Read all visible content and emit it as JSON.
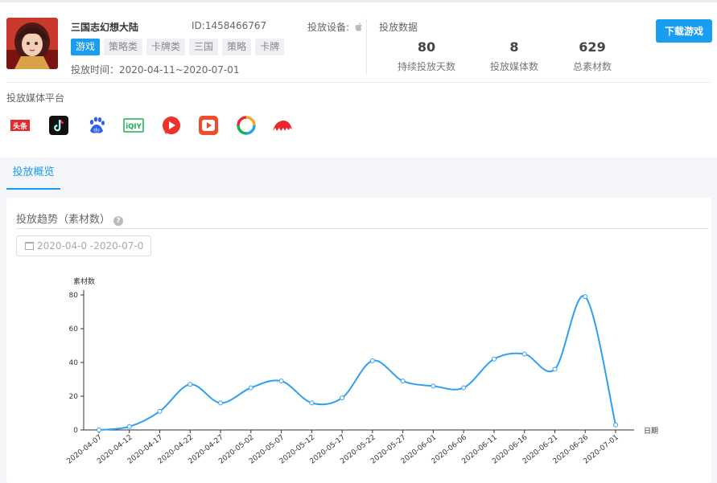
{
  "game": {
    "name": "三国志幻想大陆",
    "id": "ID:1458466767",
    "device_label": "投放设备:",
    "tags": [
      {
        "label": "游戏",
        "active": true
      },
      {
        "label": "策略类",
        "active": false
      },
      {
        "label": "卡牌类",
        "active": false
      },
      {
        "label": "三国",
        "active": false
      },
      {
        "label": "策略",
        "active": false
      },
      {
        "label": "卡牌",
        "active": false
      }
    ],
    "time": "投放时间：2020-04-11~2020-07-01"
  },
  "stats": {
    "title": "投放数据",
    "items": [
      {
        "value": "80",
        "label": "持续投放天数"
      },
      {
        "value": "8",
        "label": "投放媒体数"
      },
      {
        "value": "629",
        "label": "总素材数"
      }
    ]
  },
  "download_label": "下载游戏",
  "platforms": {
    "title": "投放媒体平台",
    "items": [
      {
        "name": "toutiao-icon",
        "text": "头条",
        "color": "#e8282b"
      },
      {
        "name": "douyin-icon",
        "text": "",
        "color": "#111111"
      },
      {
        "name": "baidu-icon",
        "text": "du",
        "color": "#2f5ee8"
      },
      {
        "name": "iqiyi-icon",
        "text": "iQIY",
        "color": "#16b24b"
      },
      {
        "name": "video-play-icon",
        "text": "",
        "color": "#f0302b"
      },
      {
        "name": "xigua-icon",
        "text": "",
        "color": "#f04b2a"
      },
      {
        "name": "ring-icon",
        "text": "",
        "color": "#2aa0e8"
      },
      {
        "name": "feather-icon",
        "text": "",
        "color": "#e8282b"
      }
    ]
  },
  "tab": {
    "label": "投放概览"
  },
  "chart_section": {
    "title": "投放趋势（素材数）",
    "date_range": "2020-04-0  -2020-07-0"
  },
  "colors": {
    "accent": "#1a9cf0",
    "line": "#2f9ff0"
  },
  "chart_data": {
    "type": "line",
    "ylabel": "素材数",
    "xlabel": "日期",
    "ylim": [
      0,
      80
    ],
    "yticks": [
      0,
      20,
      40,
      60,
      80
    ],
    "x": [
      "2020-04-07",
      "2020-04-12",
      "2020-04-17",
      "2020-04-22",
      "2020-04-27",
      "2020-05-02",
      "2020-05-07",
      "2020-05-12",
      "2020-05-17",
      "2020-05-22",
      "2020-05-27",
      "2020-06-01",
      "2020-06-06",
      "2020-06-11",
      "2020-06-16",
      "2020-06-21",
      "2020-06-26",
      "2020-07-01"
    ],
    "series": [
      {
        "name": "",
        "values": [
          0,
          2,
          11,
          27,
          16,
          25,
          29,
          16,
          19,
          41,
          29,
          26,
          25,
          42,
          45,
          36,
          79,
          3
        ]
      }
    ]
  }
}
